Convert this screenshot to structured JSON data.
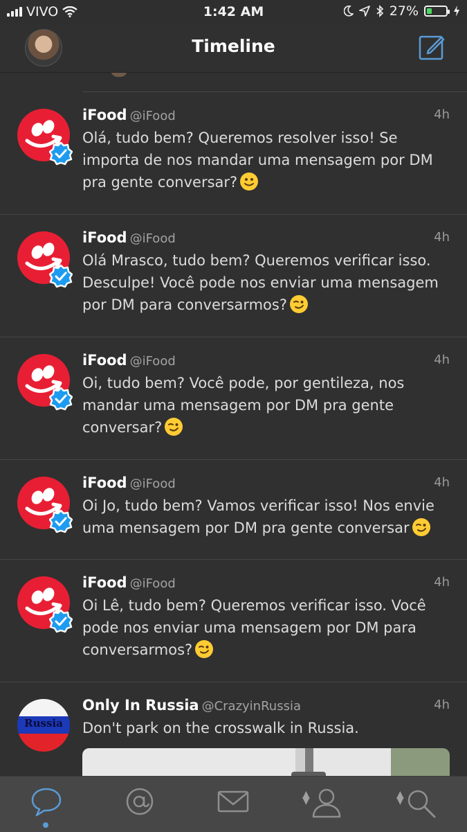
{
  "status_bar": {
    "carrier": "VIVO",
    "time": "1:42 AM",
    "battery": "27%",
    "battery_level": 0.27
  },
  "nav": {
    "title": "Timeline",
    "profile_icon": "avatar",
    "compose_icon": "compose-icon"
  },
  "tweets": [
    {
      "name": "iFood",
      "handle": "@iFood",
      "time": "4h",
      "text": "Olá, tudo bem? Queremos resolver isso! Se importa de nos mandar uma mensagem por DM pra gente conversar?",
      "emoji": "slightly-smiling-face"
    },
    {
      "name": "iFood",
      "handle": "@iFood",
      "time": "4h",
      "text": "Olá Mrasco, tudo bem? Queremos verificar isso. Desculpe! Você pode nos enviar uma mensagem por DM para conversarmos?",
      "emoji": "winking-face"
    },
    {
      "name": "iFood",
      "handle": "@iFood",
      "time": "4h",
      "text": "Oi, tudo bem? Você pode, por gentileza, nos mandar uma mensagem por DM pra gente conversar?",
      "emoji": "winking-face"
    },
    {
      "name": "iFood",
      "handle": "@iFood",
      "time": "4h",
      "text": "Oi Jo, tudo bem? Vamos verificar isso! Nos envie uma mensagem por DM pra gente conversar",
      "emoji": "winking-face"
    },
    {
      "name": "iFood",
      "handle": "@iFood",
      "time": "4h",
      "text": "Oi Lê, tudo bem? Queremos verificar isso. Você pode nos enviar uma mensagem por DM para conversarmos?",
      "emoji": "winking-face"
    },
    {
      "name": "Only In Russia",
      "handle": "@CrazyinRussia",
      "time": "4h",
      "text": "Don't park on the crosswalk in Russia.",
      "avatar_text": "Russia"
    }
  ],
  "tabbar": {
    "tabs": [
      "chat-bubble-icon",
      "at-mention-icon",
      "mail-icon",
      "profile-icon",
      "search-icon"
    ],
    "active_tab": "chat-bubble-icon"
  },
  "colors": {
    "background": "#303030",
    "ifood_red": "#e81f34",
    "accent_blue": "#5b9bd5",
    "verified_blue": "#1d9bf0",
    "battery_green": "#4cd964"
  }
}
